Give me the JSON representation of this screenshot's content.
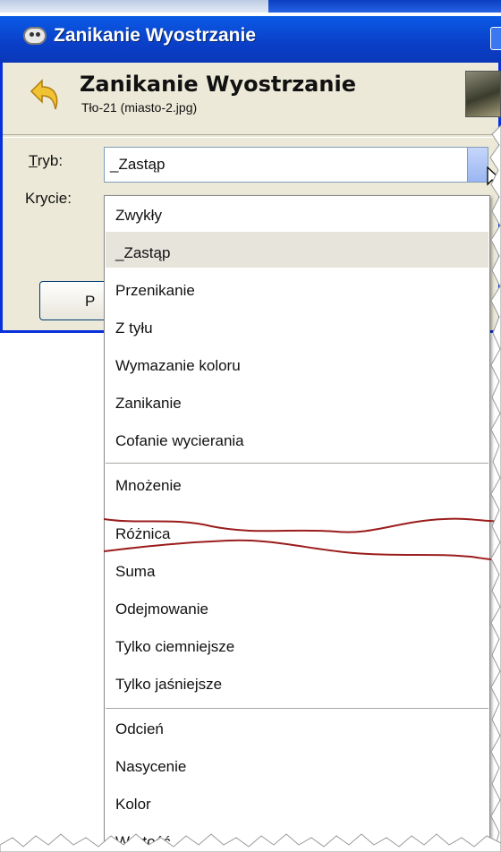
{
  "window": {
    "title": "Zanikanie Wyostrzanie"
  },
  "header": {
    "title": "Zanikanie Wyostrzanie",
    "subtitle": "Tło-21 (miasto-2.jpg)"
  },
  "form": {
    "mode_label_underlined": "T",
    "mode_label_rest": "ryb:",
    "opacity_label": "Krycie:",
    "mode_value": "_Zastąp"
  },
  "button_partial": {
    "label": "P"
  },
  "menu": {
    "items": [
      "Zwykły",
      "_Zastąp",
      "Przenikanie",
      "Z tyłu",
      "Wymazanie koloru",
      "Zanikanie",
      "Cofanie wycierania",
      "Mnożenie",
      "Różnica",
      "Suma",
      "Odejmowanie",
      "Tylko ciemniejsze",
      "Tylko jaśniejsze",
      "Odcień",
      "Nasycenie",
      "Kolor",
      "Wartość"
    ],
    "selected": "_Zastąp"
  },
  "colors": {
    "titlebar": "#0a4fd6",
    "dialog_bg": "#ece9d8",
    "highlight": "#e7e4dc",
    "scribble": "#9b1c1c"
  }
}
